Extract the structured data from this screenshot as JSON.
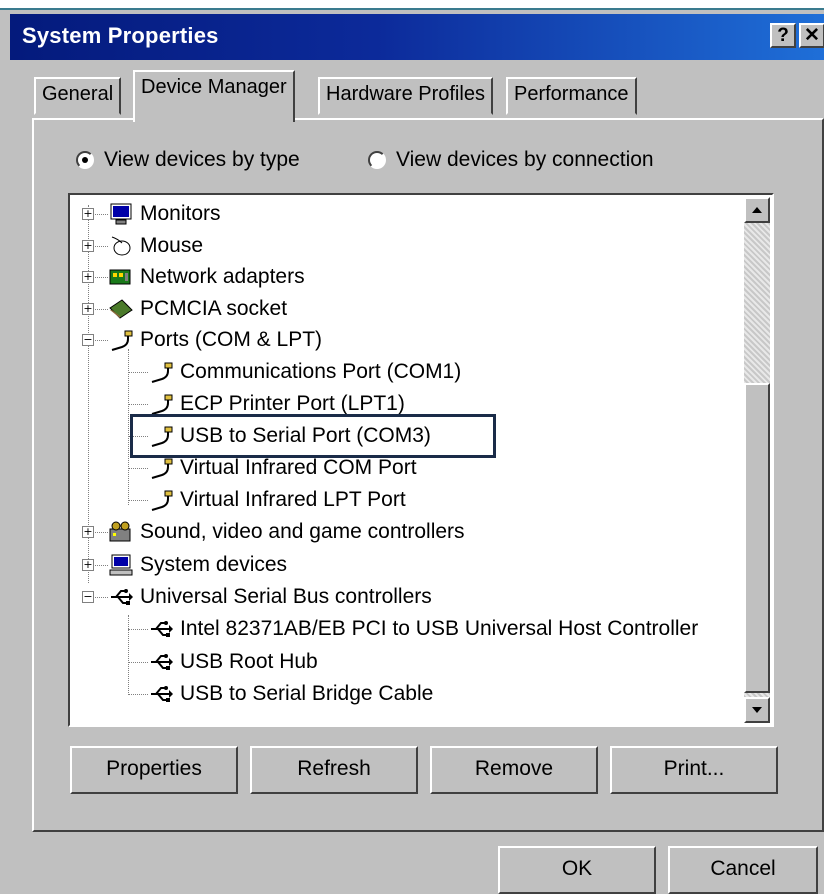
{
  "window": {
    "title": "System Properties",
    "help_label": "?",
    "close_label": "✕"
  },
  "tabs": [
    {
      "label": "General",
      "active": false
    },
    {
      "label": "Device Manager",
      "active": true
    },
    {
      "label": "Hardware Profiles",
      "active": false
    },
    {
      "label": "Performance",
      "active": false
    }
  ],
  "view": {
    "by_type_label": "View devices by type",
    "by_connection_label": "View devices by connection",
    "selected": "by_type"
  },
  "tree": [
    {
      "label": "Monitors",
      "icon": "monitor-icon",
      "expander": "+"
    },
    {
      "label": "Mouse",
      "icon": "mouse-icon",
      "expander": "+"
    },
    {
      "label": "Network adapters",
      "icon": "network-card-icon",
      "expander": "+"
    },
    {
      "label": "PCMCIA socket",
      "icon": "pcmcia-icon",
      "expander": "+"
    },
    {
      "label": "Ports (COM & LPT)",
      "icon": "port-icon",
      "expander": "−"
    },
    {
      "label": "Communications Port (COM1)",
      "icon": "port-icon"
    },
    {
      "label": "ECP Printer Port (LPT1)",
      "icon": "port-icon"
    },
    {
      "label": "USB to Serial Port (COM3)",
      "icon": "port-icon"
    },
    {
      "label": "Virtual Infrared COM Port",
      "icon": "port-icon"
    },
    {
      "label": "Virtual Infrared LPT Port",
      "icon": "port-icon"
    },
    {
      "label": "Sound, video and game controllers",
      "icon": "sound-icon",
      "expander": "+"
    },
    {
      "label": "System devices",
      "icon": "computer-icon",
      "expander": "+"
    },
    {
      "label": "Universal Serial Bus controllers",
      "icon": "usb-icon",
      "expander": "−"
    },
    {
      "label": "Intel 82371AB/EB PCI to USB Universal Host Controller",
      "icon": "usb-icon"
    },
    {
      "label": "USB Root Hub",
      "icon": "usb-icon"
    },
    {
      "label": "USB to Serial Bridge Cable",
      "icon": "usb-icon"
    }
  ],
  "buttons": {
    "properties": "Properties",
    "refresh": "Refresh",
    "remove": "Remove",
    "print": "Print...",
    "ok": "OK",
    "cancel": "Cancel"
  },
  "colors": {
    "title_start": "#041a7c",
    "title_end": "#1f6fd8",
    "highlight_border": "#1a2b48"
  }
}
